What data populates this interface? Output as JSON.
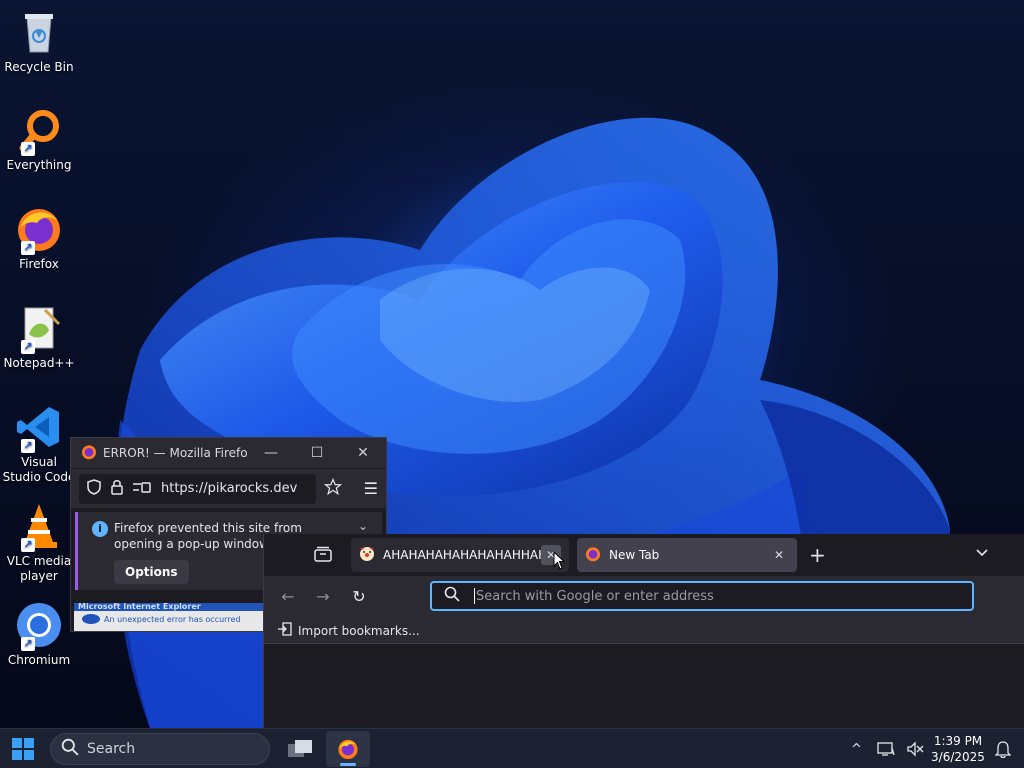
{
  "desktop": {
    "icons": [
      {
        "label": "Recycle Bin",
        "icon": "recycle-bin-icon"
      },
      {
        "label": "Everything",
        "icon": "everything-search-icon"
      },
      {
        "label": "Firefox",
        "icon": "firefox-icon"
      },
      {
        "label": "Notepad++",
        "icon": "notepadpp-icon"
      },
      {
        "label": "Visual Studio Code",
        "icon": "vscode-icon"
      },
      {
        "label": "VLC media player",
        "icon": "vlc-icon"
      },
      {
        "label": "Chromium",
        "icon": "chromium-icon"
      }
    ]
  },
  "popup_window": {
    "title": "ERROR! — Mozilla Firefox",
    "url": "https://pikarocks.dev",
    "notice_text": "Firefox prevented this site from opening a pop-up window.",
    "options_label": "Options",
    "ie_banner_title": "Microsoft Internet Explorer",
    "ie_banner_text": "An unexpected error has occurred"
  },
  "main_window": {
    "tabs": [
      {
        "label": "AHAHAHAHAHAHAHAHHAHA",
        "active": false
      },
      {
        "label": "New Tab",
        "active": true
      }
    ],
    "address_placeholder": "Search with Google or enter address",
    "bookmarks_label": "Import bookmarks..."
  },
  "taskbar": {
    "search_label": "Search",
    "time": "1:39 PM",
    "date": "3/6/2025"
  },
  "colors": {
    "accent": "#5fb4ff",
    "taskbar_bg": "#1c2231",
    "browser_bg": "#1c1b22"
  }
}
